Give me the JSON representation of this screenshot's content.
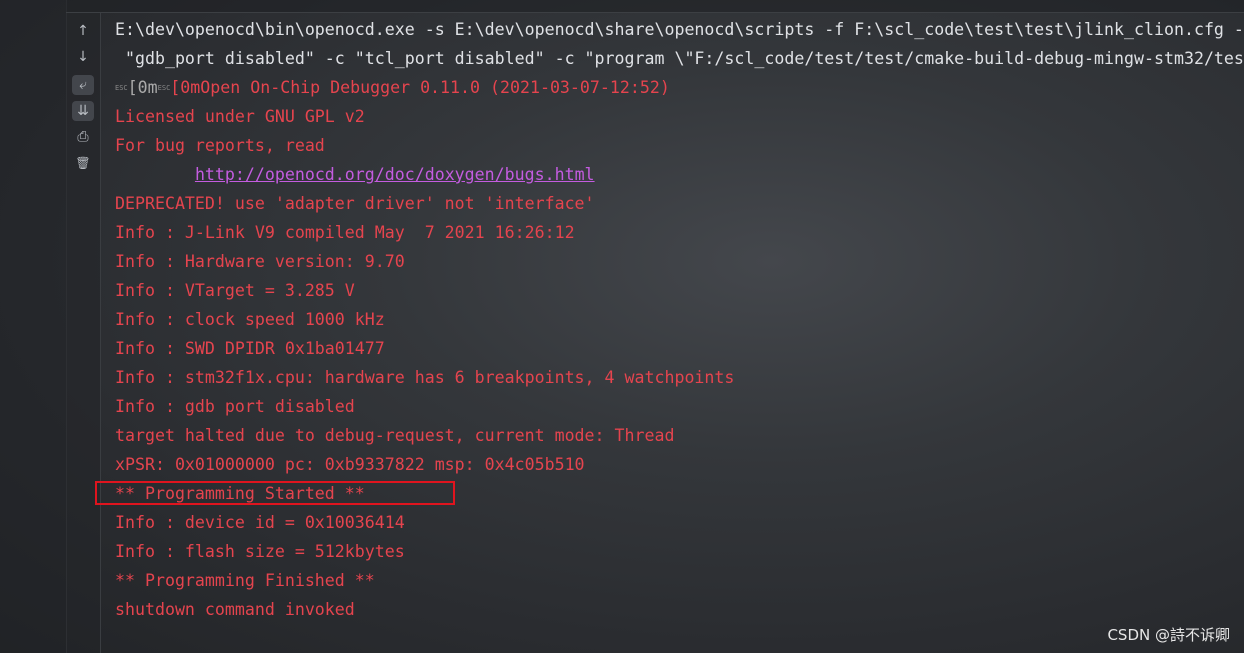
{
  "toolbar": {
    "items": [
      {
        "icon": "arrow-up-icon",
        "glyph": "↑"
      },
      {
        "icon": "arrow-down-icon",
        "glyph": "↓"
      },
      {
        "icon": "soft-wrap-icon",
        "glyph": "⤶"
      },
      {
        "icon": "scroll-to-end-icon",
        "glyph": "⇊"
      },
      {
        "icon": "print-icon",
        "glyph": "⎙"
      },
      {
        "icon": "trash-icon",
        "glyph": "🗑"
      }
    ]
  },
  "console": {
    "cmd1": "E:\\dev\\openocd\\bin\\openocd.exe -s E:\\dev\\openocd\\share\\openocd\\scripts -f F:\\scl_code\\test\\test\\jlink_clion.cfg -",
    "cmd2": " \"gdb_port disabled\" -c \"tcl_port disabled\" -c \"program \\\"F:/scl_code/test/test/cmake-build-debug-mingw-stm32/tes",
    "esc_label": "ESC",
    "esc_seq1": "[0m",
    "esc_seq2": "[0m",
    "banner": "Open On-Chip Debugger 0.11.0 (2021-03-07-12:52)",
    "license": "Licensed under GNU GPL v2",
    "bugs": "For bug reports, read",
    "link_indent": "        ",
    "link": "http://openocd.org/doc/doxygen/bugs.html",
    "lines": [
      "DEPRECATED! use 'adapter driver' not 'interface'",
      "Info : J-Link V9 compiled May  7 2021 16:26:12",
      "Info : Hardware version: 9.70",
      "Info : VTarget = 3.285 V",
      "Info : clock speed 1000 kHz",
      "Info : SWD DPIDR 0x1ba01477",
      "Info : stm32f1x.cpu: hardware has 6 breakpoints, 4 watchpoints",
      "Info : gdb port disabled",
      "target halted due to debug-request, current mode: Thread",
      "xPSR: 0x01000000 pc: 0xb9337822 msp: 0x4c05b510",
      "** Programming Started **",
      "Info : device id = 0x10036414",
      "Info : flash size = 512kbytes",
      "** Programming Finished **",
      "shutdown command invoked"
    ]
  },
  "colors": {
    "error_text": "#e5444e",
    "command_text": "#dfe1e5",
    "link": "#c45ce0",
    "highlight_box": "#e0141e"
  },
  "watermark": "CSDN @詩不诉卿"
}
